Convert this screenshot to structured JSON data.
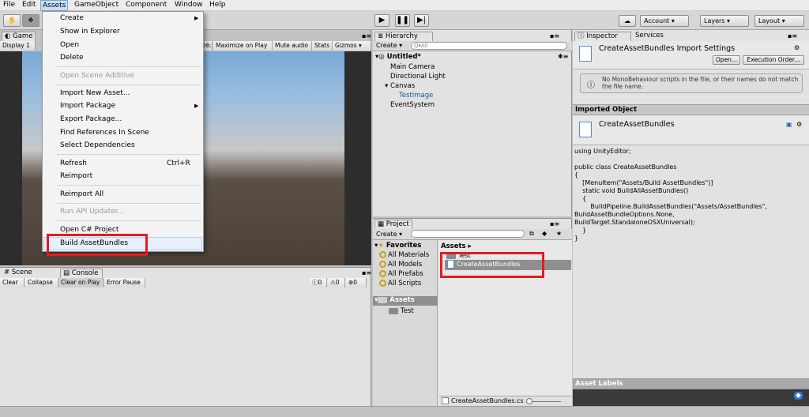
{
  "menubar": {
    "items": [
      "File",
      "Edit",
      "Assets",
      "GameObject",
      "Component",
      "Window",
      "Help"
    ]
  },
  "toolbar": {
    "account": "Account",
    "layers": "Layers",
    "layout": "Layout"
  },
  "game": {
    "tab_game": "Game",
    "tab_display": "Display 1",
    "scale_partial": "56:",
    "maximize": "Maximize on Play",
    "mute": "Mute audio",
    "stats": "Stats",
    "gizmos": "Gizmos"
  },
  "console": {
    "tab_scene": "Scene",
    "tab_console": "Console",
    "clear": "Clear",
    "collapse": "Collapse",
    "clear_on_play": "Clear on Play",
    "error_pause": "Error Pause",
    "count_info": "0",
    "count_warn": "0",
    "count_error": "0"
  },
  "hierarchy": {
    "tab": "Hierarchy",
    "create": "Create",
    "search_placeholder": "Q▾All",
    "scene": "Untitled*",
    "items": [
      "Main Camera",
      "Directional Light",
      "Canvas",
      "TestImage",
      "EventSystem"
    ]
  },
  "project": {
    "tab": "Project",
    "create": "Create",
    "favorites": "Favorites",
    "fav_items": [
      "All Materials",
      "All Models",
      "All Prefabs",
      "All Scripts"
    ],
    "assets_root": "Assets",
    "tree_items": [
      "Test"
    ],
    "breadcrumb": "Assets",
    "files": [
      "Test",
      "CreateAssetBundles"
    ],
    "status_file": "CreateAssetBundles.cs"
  },
  "inspector": {
    "tab_inspector": "Inspector",
    "tab_services": "Services",
    "title": "CreateAssetBundles Import Settings",
    "open_btn": "Open...",
    "exec_btn": "Execution Order...",
    "warning": "No MonoBehaviour scripts in the file, or their names do not match the file name.",
    "imported_object": "Imported Object",
    "object_name": "CreateAssetBundles",
    "code": [
      "using UnityEditor;",
      "",
      "public class CreateAssetBundles",
      "{",
      "    [MenuItem(\"Assets/Build AssetBundles\")]",
      "    static void BuildAllAssetBundles()",
      "    {",
      "        BuildPipeline.BuildAssetBundles(\"Assets/AssetBundles\",",
      "BuildAssetBundleOptions.None,",
      "BuildTarget.StandaloneOSXUniversal);",
      "    }",
      "}"
    ],
    "asset_labels": "Asset Labels"
  },
  "assets_menu": {
    "items": [
      {
        "label": "Create",
        "disabled": false,
        "arrow": true
      },
      {
        "label": "Show in Explorer",
        "disabled": false
      },
      {
        "label": "Open",
        "disabled": false
      },
      {
        "label": "Delete",
        "disabled": false
      },
      {
        "label": "Open Scene Additive",
        "disabled": true
      },
      {
        "label": "Import New Asset...",
        "disabled": false
      },
      {
        "label": "Import Package",
        "disabled": false,
        "arrow": true
      },
      {
        "label": "Export Package...",
        "disabled": false
      },
      {
        "label": "Find References In Scene",
        "disabled": false
      },
      {
        "label": "Select Dependencies",
        "disabled": false
      },
      {
        "label": "Refresh",
        "disabled": false,
        "shortcut": "Ctrl+R"
      },
      {
        "label": "Reimport",
        "disabled": false
      },
      {
        "label": "Reimport All",
        "disabled": false
      },
      {
        "label": "Run API Updater...",
        "disabled": true
      },
      {
        "label": "Open C# Project",
        "disabled": false
      },
      {
        "label": "Build AssetBundles",
        "disabled": false
      }
    ]
  },
  "colors": {
    "highlight": "#e21b23",
    "selection": "#3d77c5"
  }
}
